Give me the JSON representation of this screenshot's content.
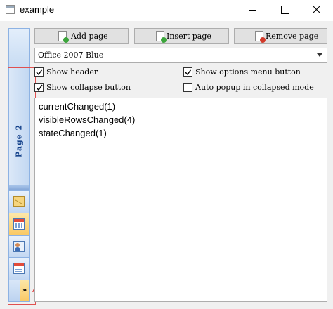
{
  "window": {
    "title": "example"
  },
  "toolbar": {
    "add_label": "Add page",
    "insert_label": "Insert page",
    "remove_label": "Remove page"
  },
  "style_combo": {
    "value": "Office 2007 Blue"
  },
  "options": [
    {
      "label": "Show header",
      "checked": true
    },
    {
      "label": "Show options menu button",
      "checked": true
    },
    {
      "label": "Show collapse button",
      "checked": true
    },
    {
      "label": "Auto popup in collapsed mode",
      "checked": false
    }
  ],
  "navbar": {
    "current_page": "Page 2",
    "buttons": [
      "mail-icon",
      "calendar-icon",
      "contacts-icon",
      "tasks-icon"
    ],
    "active_index": 1,
    "menu_glyph": "»"
  },
  "log": [
    "currentChanged(1)",
    "visibleRowsChanged(4)",
    "stateChanged(1)"
  ],
  "colors": {
    "annotation": "#e05050",
    "nav_active": "#f9c965",
    "nav_text": "#15428b"
  }
}
